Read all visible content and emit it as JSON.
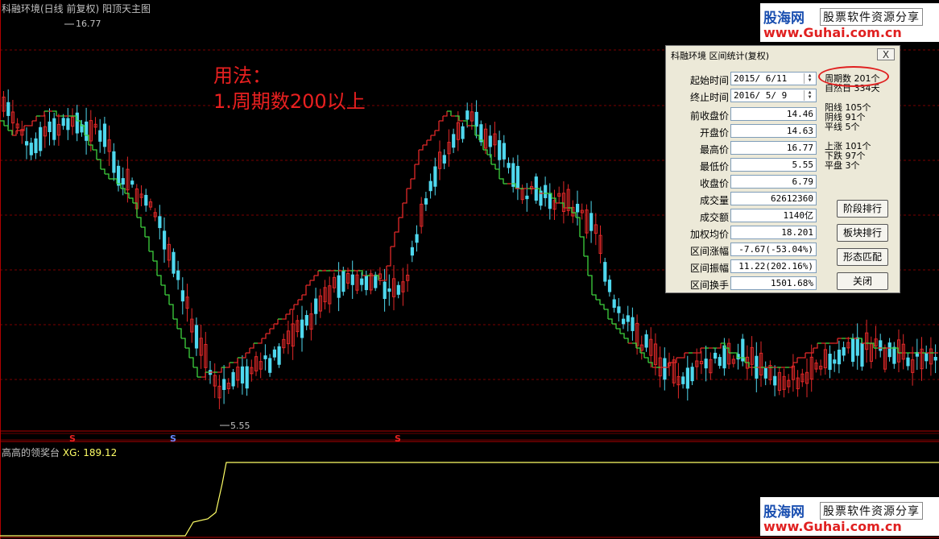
{
  "main_chart": {
    "title": "科融环境(日线 前复权) 阳顶天主图",
    "high_label": "16.77",
    "low_label": "5.55",
    "usage_line1": "用法：",
    "usage_line2": "1.周期数200以上",
    "signal_marks": [
      "S",
      "S",
      "S"
    ],
    "colors": {
      "up": "#e02828",
      "down": "#4fd8ee",
      "line_up": "#e02828",
      "line_down": "#3ed23e",
      "grid": "#7a0000"
    }
  },
  "indicator": {
    "title": "高高的领奖台",
    "xg_label": "XG:",
    "xg_value": "189.12",
    "line_color": "#ffff66"
  },
  "watermark": {
    "brand": "股海网",
    "subtitle": "股票软件资源分享",
    "url": "www.Guhai.com.cn"
  },
  "dialog": {
    "title": "科融环境 区间统计(复权)",
    "close_label": "X",
    "fields": [
      {
        "label": "起始时间",
        "value": "2015/ 6/11"
      },
      {
        "label": "终止时间",
        "value": "2016/ 5/ 9"
      },
      {
        "label": "前收盘价",
        "value": "14.46"
      },
      {
        "label": "开盘价",
        "value": "14.63"
      },
      {
        "label": "最高价",
        "value": "16.77"
      },
      {
        "label": "最低价",
        "value": "5.55"
      },
      {
        "label": "收盘价",
        "value": "6.79"
      },
      {
        "label": "成交量",
        "value": "62612360"
      },
      {
        "label": "成交额",
        "value": "1140亿"
      },
      {
        "label": "加权均价",
        "value": "18.201"
      },
      {
        "label": "区间涨幅",
        "value": "-7.67(-53.04%)"
      },
      {
        "label": "区间振幅",
        "value": "11.22(202.16%)"
      },
      {
        "label": "区间换手",
        "value": "1501.68%"
      }
    ],
    "stats": {
      "period_count": "周期数 201个",
      "natural_days": "自然日 334天",
      "yang": "阳线 105个",
      "yin": "阴线 91个",
      "flat_line": "平线 5个",
      "rise": "上涨 101个",
      "fall": "下跌 97个",
      "flat": "平盘 3个"
    },
    "buttons": [
      "阶段排行",
      "板块排行",
      "形态匹配",
      "关闭"
    ]
  }
}
